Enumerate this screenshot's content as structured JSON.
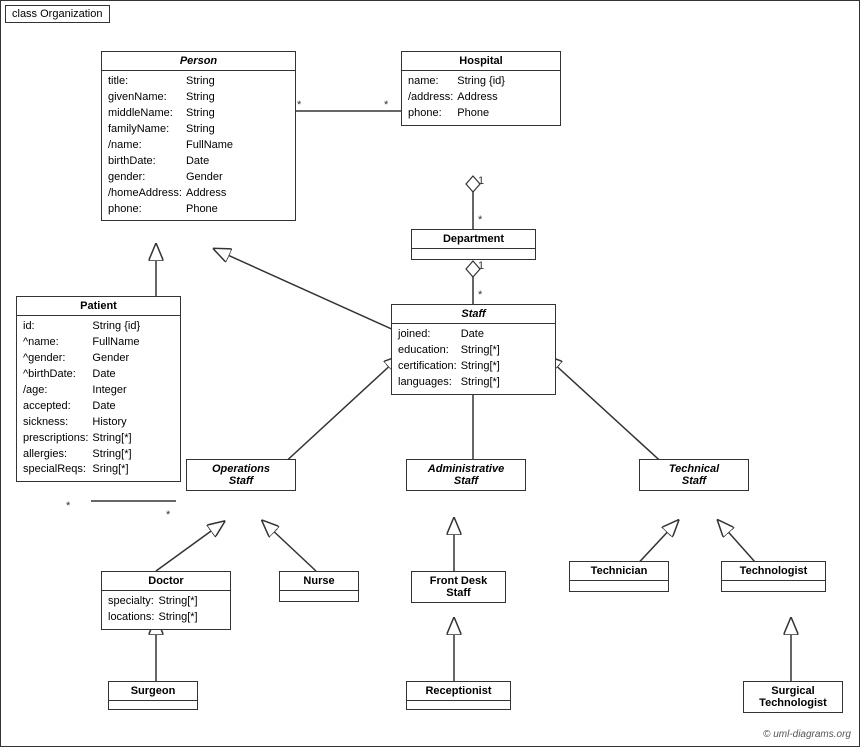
{
  "diagram": {
    "title": "class Organization",
    "classes": {
      "person": {
        "name": "Person",
        "italic": true,
        "attributes": [
          [
            "title:",
            "String"
          ],
          [
            "givenName:",
            "String"
          ],
          [
            "middleName:",
            "String"
          ],
          [
            "familyName:",
            "String"
          ],
          [
            "/name:",
            "FullName"
          ],
          [
            "birthDate:",
            "Date"
          ],
          [
            "gender:",
            "Gender"
          ],
          [
            "/homeAddress:",
            "Address"
          ],
          [
            "phone:",
            "Phone"
          ]
        ]
      },
      "hospital": {
        "name": "Hospital",
        "italic": false,
        "attributes": [
          [
            "name:",
            "String {id}"
          ],
          [
            "/address:",
            "Address"
          ],
          [
            "phone:",
            "Phone"
          ]
        ]
      },
      "patient": {
        "name": "Patient",
        "italic": false,
        "attributes": [
          [
            "id:",
            "String {id}"
          ],
          [
            "^name:",
            "FullName"
          ],
          [
            "^gender:",
            "Gender"
          ],
          [
            "^birthDate:",
            "Date"
          ],
          [
            "/age:",
            "Integer"
          ],
          [
            "accepted:",
            "Date"
          ],
          [
            "sickness:",
            "History"
          ],
          [
            "prescriptions:",
            "String[*]"
          ],
          [
            "allergies:",
            "String[*]"
          ],
          [
            "specialReqs:",
            "Sring[*]"
          ]
        ]
      },
      "department": {
        "name": "Department",
        "italic": false,
        "attributes": []
      },
      "staff": {
        "name": "Staff",
        "italic": true,
        "attributes": [
          [
            "joined:",
            "Date"
          ],
          [
            "education:",
            "String[*]"
          ],
          [
            "certification:",
            "String[*]"
          ],
          [
            "languages:",
            "String[*]"
          ]
        ]
      },
      "ops_staff": {
        "name": "Operations\nStaff",
        "italic": true
      },
      "admin_staff": {
        "name": "Administrative\nStaff",
        "italic": true
      },
      "tech_staff": {
        "name": "Technical\nStaff",
        "italic": true
      },
      "doctor": {
        "name": "Doctor",
        "attributes": [
          [
            "specialty:",
            "String[*]"
          ],
          [
            "locations:",
            "String[*]"
          ]
        ]
      },
      "nurse": {
        "name": "Nurse"
      },
      "front_desk": {
        "name": "Front Desk\nStaff"
      },
      "technician": {
        "name": "Technician"
      },
      "technologist": {
        "name": "Technologist"
      },
      "surgeon": {
        "name": "Surgeon"
      },
      "receptionist": {
        "name": "Receptionist"
      },
      "surgical_tech": {
        "name": "Surgical\nTechnologist"
      }
    },
    "copyright": "© uml-diagrams.org"
  }
}
